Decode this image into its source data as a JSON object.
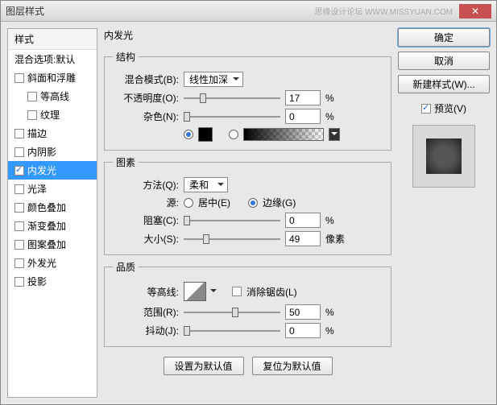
{
  "window": {
    "title": "图层样式",
    "watermark": "思缘设计论坛  WWW.MISSYUAN.COM"
  },
  "left": {
    "header": "样式",
    "blend_defaults": "混合选项:默认",
    "items": [
      {
        "label": "斜面和浮雕",
        "checked": false,
        "indent": false
      },
      {
        "label": "等高线",
        "checked": false,
        "indent": true
      },
      {
        "label": "纹理",
        "checked": false,
        "indent": true
      },
      {
        "label": "描边",
        "checked": false,
        "indent": false
      },
      {
        "label": "内阴影",
        "checked": false,
        "indent": false
      },
      {
        "label": "内发光",
        "checked": true,
        "indent": false,
        "selected": true
      },
      {
        "label": "光泽",
        "checked": false,
        "indent": false
      },
      {
        "label": "颜色叠加",
        "checked": false,
        "indent": false
      },
      {
        "label": "渐变叠加",
        "checked": false,
        "indent": false
      },
      {
        "label": "图案叠加",
        "checked": false,
        "indent": false
      },
      {
        "label": "外发光",
        "checked": false,
        "indent": false
      },
      {
        "label": "投影",
        "checked": false,
        "indent": false
      }
    ]
  },
  "middle": {
    "title": "内发光",
    "structure": {
      "legend": "结构",
      "blend_mode_label": "混合模式(B):",
      "blend_mode_value": "线性加深",
      "opacity_label": "不透明度(O):",
      "opacity_value": "17",
      "opacity_unit": "%",
      "noise_label": "杂色(N):",
      "noise_value": "0",
      "noise_unit": "%"
    },
    "elements": {
      "legend": "图素",
      "method_label": "方法(Q):",
      "method_value": "柔和",
      "source_label": "源:",
      "source_center": "居中(E)",
      "source_edge": "边缘(G)",
      "choke_label": "阻塞(C):",
      "choke_value": "0",
      "choke_unit": "%",
      "size_label": "大小(S):",
      "size_value": "49",
      "size_unit": "像素"
    },
    "quality": {
      "legend": "品质",
      "contour_label": "等高线:",
      "anti_alias_label": "消除锯齿(L)",
      "range_label": "范围(R):",
      "range_value": "50",
      "range_unit": "%",
      "jitter_label": "抖动(J):",
      "jitter_value": "0",
      "jitter_unit": "%"
    },
    "buttons": {
      "make_default": "设置为默认值",
      "reset_default": "复位为默认值"
    }
  },
  "right": {
    "ok": "确定",
    "cancel": "取消",
    "new_style": "新建样式(W)...",
    "preview": "预览(V)"
  }
}
